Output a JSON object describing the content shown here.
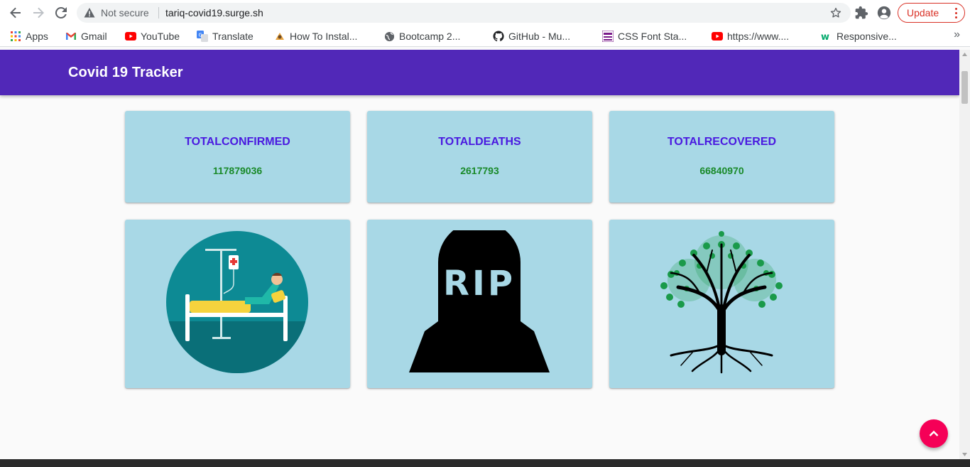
{
  "browser": {
    "security_label": "Not secure",
    "url": "tariq-covid19.surge.sh",
    "update_label": "Update",
    "bookmarks": [
      {
        "label": "Apps",
        "icon": "apps-grid-icon"
      },
      {
        "label": "Gmail",
        "icon": "gmail-icon"
      },
      {
        "label": "YouTube",
        "icon": "youtube-icon"
      },
      {
        "label": "Translate",
        "icon": "translate-icon"
      },
      {
        "label": "How To Instal...",
        "icon": "site-icon"
      },
      {
        "label": "Bootcamp 2...",
        "icon": "globe-icon"
      },
      {
        "label": "GitHub - Mu...",
        "icon": "github-icon"
      },
      {
        "label": "CSS Font Sta...",
        "icon": "css-font-stack-icon"
      },
      {
        "label": "https://www....",
        "icon": "youtube-icon"
      },
      {
        "label": "Responsive...",
        "icon": "w3schools-icon"
      }
    ]
  },
  "app": {
    "title": "Covid 19 Tracker"
  },
  "stats": [
    {
      "label": "TOTALCONFIRMED",
      "value": "117879036",
      "image": "hospital-patient-illustration"
    },
    {
      "label": "TOTALDEATHS",
      "value": "2617793",
      "image": "rip-tombstone-illustration"
    },
    {
      "label": "TOTALRECOVERED",
      "value": "66840970",
      "image": "tree-illustration"
    }
  ],
  "colors": {
    "appbar": "#5128b8",
    "card": "#a8d8e6",
    "stat_label": "#4a1ae0",
    "stat_value": "#1a8a2a",
    "fab": "#f50057"
  }
}
